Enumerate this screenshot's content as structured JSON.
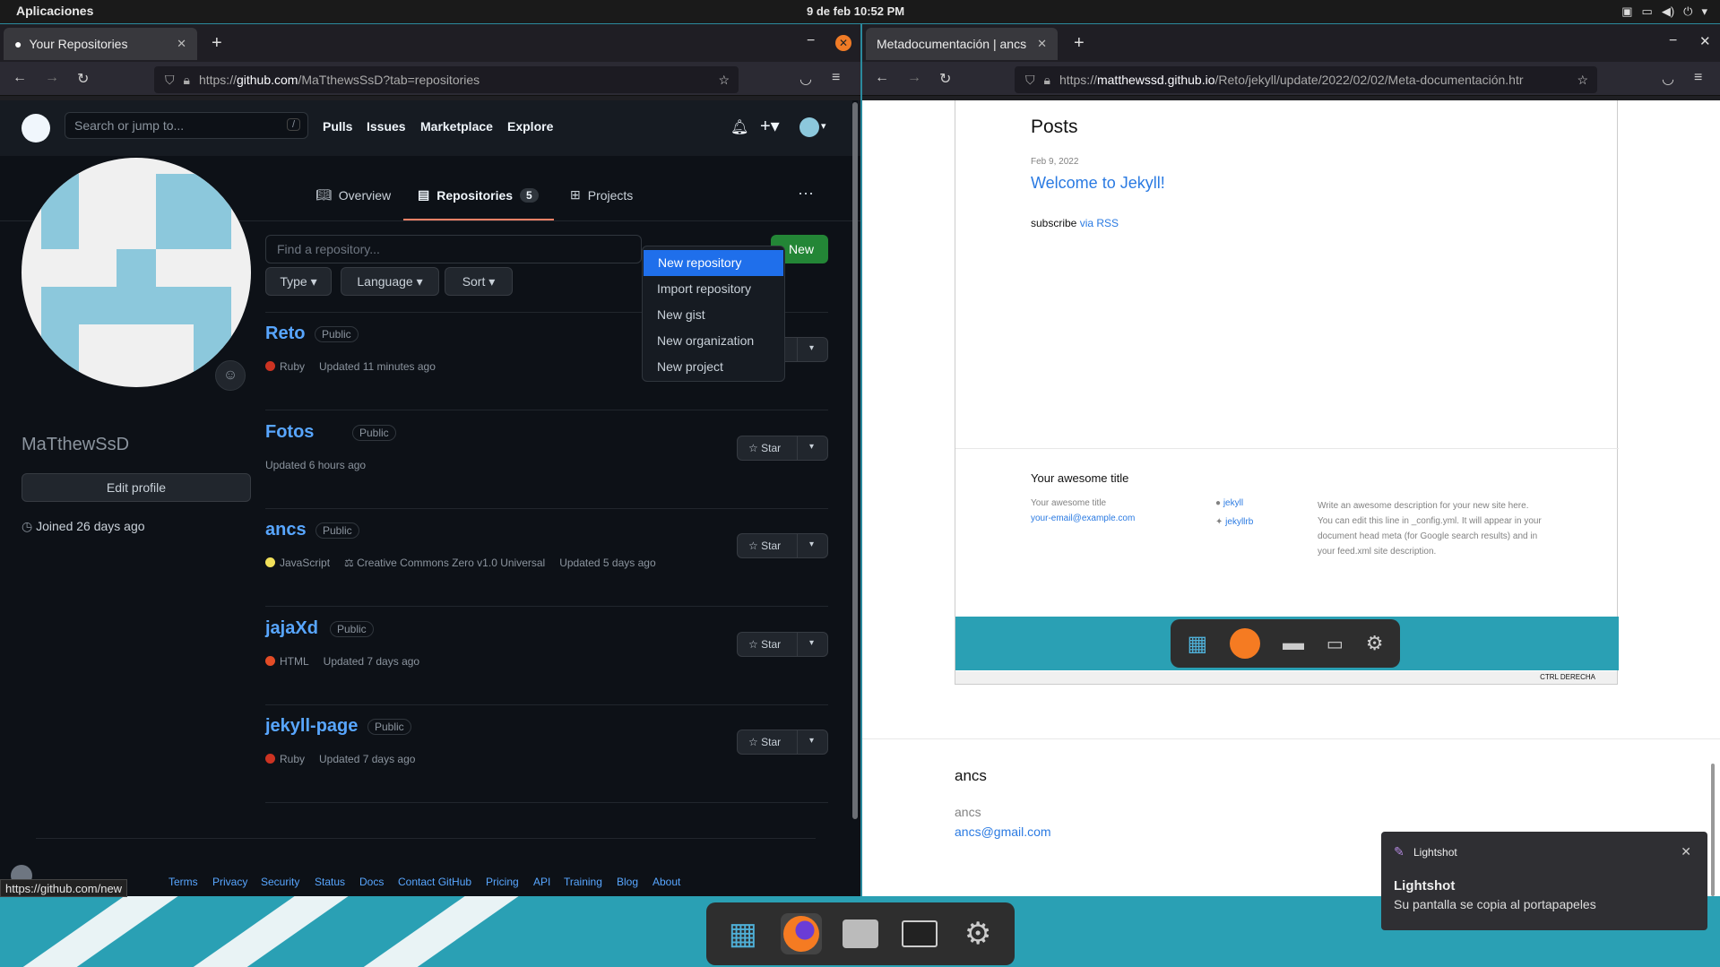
{
  "topbar": {
    "apps": "Aplicaciones",
    "clock": "9 de feb  10:52 PM"
  },
  "left_browser": {
    "tab_title": "Your Repositories",
    "url_prefix": "https://",
    "url_domain": "github.com",
    "url_path": "/MaTthewsSsD?tab=repositories",
    "status_url": "https://github.com/new"
  },
  "github": {
    "search_placeholder": "Search or jump to...",
    "search_key": "/",
    "nav": {
      "pulls": "Pulls",
      "issues": "Issues",
      "marketplace": "Marketplace",
      "explore": "Explore"
    },
    "tabs": {
      "overview": "Overview",
      "repositories": "Repositories",
      "repositories_count": "5",
      "projects": "Projects"
    },
    "create_menu": [
      "New repository",
      "Import repository",
      "New gist",
      "New organization",
      "New project"
    ],
    "username": "MaTthewSsD",
    "edit_profile": "Edit profile",
    "joined": "Joined 26 days ago",
    "find_placeholder": "Find a repository...",
    "new_button": "New",
    "filters": {
      "type": "Type",
      "language": "Language",
      "sort": "Sort"
    },
    "star_label": "Star",
    "repos": [
      {
        "name": "Reto",
        "visibility": "Public",
        "language": "Ruby",
        "lang_color": "#cc3322",
        "license": "",
        "updated": "Updated 11 minutes ago"
      },
      {
        "name": "Fotos",
        "visibility": "Public",
        "language": "",
        "lang_color": "",
        "license": "",
        "updated": "Updated 6 hours ago"
      },
      {
        "name": "ancs",
        "visibility": "Public",
        "language": "JavaScript",
        "lang_color": "#f1e05a",
        "license": "Creative Commons Zero v1.0 Universal",
        "updated": "Updated 5 days ago"
      },
      {
        "name": "jajaXd",
        "visibility": "Public",
        "language": "HTML",
        "lang_color": "#e34c26",
        "license": "",
        "updated": "Updated 7 days ago"
      },
      {
        "name": "jekyll-page",
        "visibility": "Public",
        "language": "Ruby",
        "lang_color": "#cc3322",
        "license": "",
        "updated": "Updated 7 days ago"
      }
    ],
    "footer": [
      "Terms",
      "Privacy",
      "Security",
      "Status",
      "Docs",
      "Contact GitHub",
      "Pricing",
      "API",
      "Training",
      "Blog",
      "About"
    ]
  },
  "right_browser": {
    "tab_title": "Metadocumentación | ancs",
    "url_prefix": "https://",
    "url_domain": "matthewssd.github.io",
    "url_path": "/Reto/jekyll/update/2022/02/02/Meta-documentación.htr"
  },
  "jekyll": {
    "posts_heading": "Posts",
    "post_date": "Feb 9, 2022",
    "post_title": "Welcome to Jekyll!",
    "subscribe": "subscribe",
    "via_rss": "via RSS",
    "footer_title": "Your awesome title",
    "footer_sub": "Your awesome title",
    "footer_email": "your-email@example.com",
    "github_user": "jekyll",
    "twitter_user": "jekyllrb",
    "description": "Write an awesome description for your new site here. You can edit this line in _config.yml. It will appear in your document head meta (for Google search results) and in your feed.xml site description.",
    "vm_status": "CTRL DERECHA"
  },
  "page_footer": {
    "title": "ancs",
    "name": "ancs",
    "email": "ancs@gmail.com"
  },
  "notification": {
    "app": "Lightshot",
    "title": "Lightshot",
    "body": "Su pantalla se copia al portapapeles"
  }
}
